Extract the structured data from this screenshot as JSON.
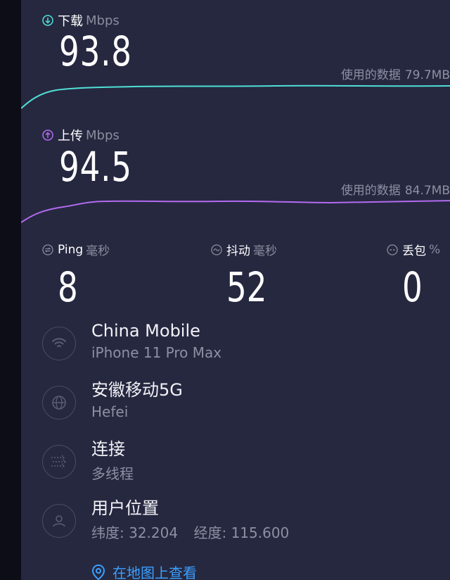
{
  "download": {
    "label": "下载",
    "unit": "Mbps",
    "value": "93.8",
    "used_label": "使用的数据",
    "used_value": "79.7MB",
    "color": "#4fe0d6"
  },
  "upload": {
    "label": "上传",
    "unit": "Mbps",
    "value": "94.5",
    "used_label": "使用的数据",
    "used_value": "84.7MB",
    "color": "#b26bf0"
  },
  "stats": {
    "ping": {
      "label": "Ping",
      "unit": "毫秒",
      "value": "8",
      "icon": "ping-icon"
    },
    "jitter": {
      "label": "抖动",
      "unit": "毫秒",
      "value": "52",
      "icon": "jitter-icon"
    },
    "loss": {
      "label": "丢包",
      "unit": "%",
      "value": "0",
      "icon": "packet-loss-icon"
    }
  },
  "info": {
    "provider": {
      "title": "China Mobile",
      "subtitle": "iPhone 11 Pro Max",
      "icon": "wifi-icon"
    },
    "server": {
      "title": "安徽移动5G",
      "subtitle": "Hefei",
      "icon": "globe-icon"
    },
    "connection": {
      "title": "连接",
      "subtitle": "多线程",
      "icon": "multi-thread-icon"
    },
    "location": {
      "title": "用户位置",
      "lat_label": "纬度:",
      "lat": "32.204",
      "lon_label": "经度:",
      "lon": "115.600",
      "icon": "user-icon"
    }
  },
  "map_link": {
    "label": "在地图上查看",
    "icon": "map-pin-icon",
    "color": "#3aa0ff"
  }
}
